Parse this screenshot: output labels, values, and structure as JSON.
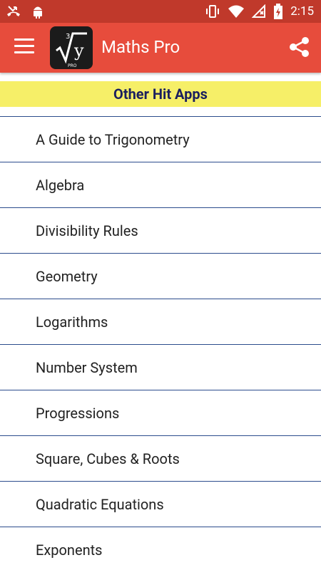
{
  "status_bar": {
    "time": "2:15",
    "icons_left": [
      "missed-call-icon",
      "android-icon"
    ],
    "icons_right": [
      "vibrate-icon",
      "wifi-icon",
      "no-sim-icon",
      "battery-charging-icon"
    ]
  },
  "app_bar": {
    "title": "Maths Pro",
    "logo_text": "y",
    "logo_root": "3",
    "logo_sub": "PRO",
    "menu_icon": "hamburger-menu-icon",
    "share_icon": "share-icon"
  },
  "section": {
    "header": "Other Hit Apps"
  },
  "items": [
    {
      "label": "A Guide to Trigonometry"
    },
    {
      "label": "Algebra"
    },
    {
      "label": "Divisibility Rules"
    },
    {
      "label": "Geometry"
    },
    {
      "label": "Logarithms"
    },
    {
      "label": "Number System"
    },
    {
      "label": "Progressions"
    },
    {
      "label": "Square, Cubes & Roots"
    },
    {
      "label": "Quadratic Equations"
    },
    {
      "label": "Exponents"
    }
  ],
  "colors": {
    "status_bar": "#c0392b",
    "app_bar": "#e74c3c",
    "header_bg": "#f6ef68",
    "header_text": "#1b1f5e",
    "divider": "#2b4c8c"
  }
}
